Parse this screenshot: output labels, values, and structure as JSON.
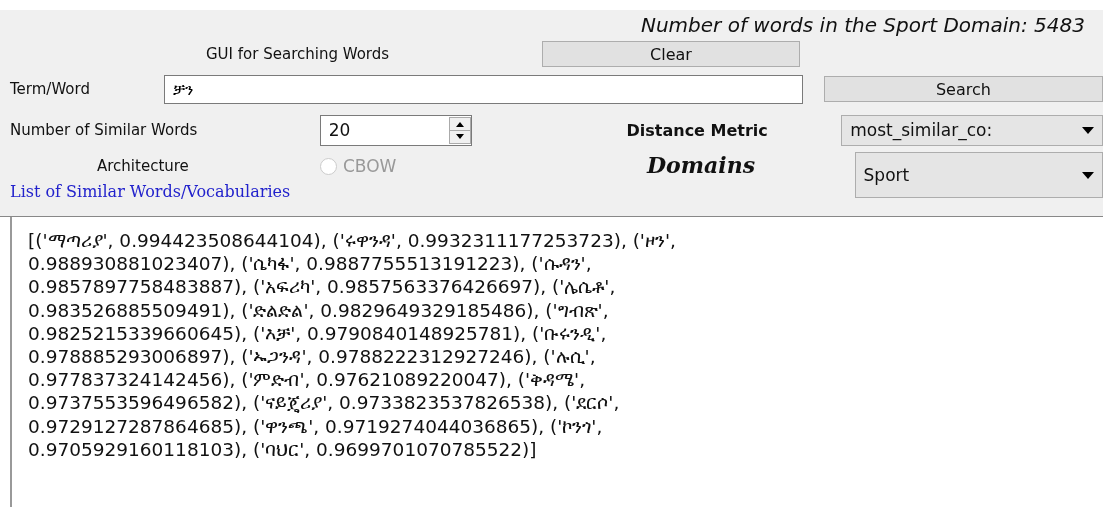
{
  "header": {
    "word_count": "Number of words in the Sport Domain: 5483"
  },
  "gui_label": "GUI for Searching Words",
  "clear_button": "Clear",
  "term": {
    "label": "Term/Word",
    "value": "ቻን"
  },
  "search_button": "Search",
  "similar_count": {
    "label": "Number of Similar Words",
    "value": "20"
  },
  "distance_metric": {
    "label": "Distance Metric",
    "value": "most_similar_co:"
  },
  "architecture": {
    "label": "Architecture",
    "option": {
      "label": "CBOW",
      "checked": false,
      "disabled": true
    }
  },
  "domains": {
    "label": "Domains",
    "value": "Sport"
  },
  "list_title": "List of Similar Words/Vocabularies",
  "result_lines": [
    "[('ማጣሪያ', 0.994423508644104), ('ሩዋንዳ', 0.9932311177253723), ('ዞን',",
    "0.988930881023407), ('ሴካፋ', 0.9887755513191223), ('ሱዳን',",
    "0.9857897758483887), ('አፍሪካ', 0.9857563376426697), ('ሌሴቶ',",
    "0.983526885509491), ('ድልድል', 0.9829649329185486), ('ግብጽ',",
    "0.9825215339660645), ('እቻ', 0.9790840148925781), ('ቡሩንዲ',",
    "0.978885293006897), ('ኡጋንዳ', 0.9788222312927246), ('ሉሲ',",
    "0.977837324142456), ('ምድብ', 0.97621089220047), ('ቅዳሜ',",
    "0.9737553596496582), ('ናይጄሪያ', 0.9733823537826538), ('ደርሶ',",
    "0.9729127287864685), ('ዋንጫ', 0.9719274044036865), ('ኮንጎ',",
    "0.9705929160118103), ('ባህር', 0.9699701070785522)]"
  ]
}
